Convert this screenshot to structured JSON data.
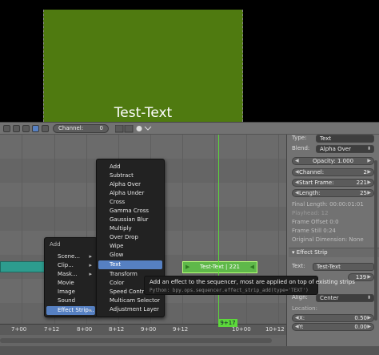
{
  "preview": {
    "text": "Test-Text"
  },
  "header": {
    "channel_label": "Channel:",
    "channel_value": "0"
  },
  "strip": {
    "label": "Test-Text | 221"
  },
  "ruler": {
    "ticks": [
      "7+00",
      "7+12",
      "8+00",
      "8+12",
      "9+00",
      "9+12",
      "10+00",
      "10+12"
    ],
    "current_frame": "9+17"
  },
  "properties": {
    "type_label": "Type:",
    "type_value": "Text",
    "blend_label": "Blend:",
    "blend_value": "Alpha Over",
    "opacity_label": "Opacity:",
    "opacity_value": "1.000",
    "channel_label": "Channel:",
    "channel_value": "2",
    "start_label": "Start Frame:",
    "start_value": "221",
    "length_label": "Length:",
    "length_value": "25",
    "final_length": "Final Length: 00:00:01:01",
    "playhead": "Playhead: 12",
    "frame_offset": "Frame Offset 0:0",
    "frame_still": "Frame Still 0:24",
    "orig_dim": "Original Dimension: None",
    "effect_strip_title": "Effect Strip",
    "text_label": "Text:",
    "text_value": "Test-Text",
    "size_value": "139",
    "align_label": "Align:",
    "align_value": "Center",
    "location_label": "Location:",
    "x_label": "X:",
    "x_value": "0.50",
    "y_label": "Y:",
    "y_value": "0.00"
  },
  "add_menu": {
    "title": "Add",
    "items": [
      {
        "label": "Scene..."
      },
      {
        "label": "Clip..."
      },
      {
        "label": "Mask..."
      },
      {
        "label": "Movie"
      },
      {
        "label": "Image"
      },
      {
        "label": "Sound"
      },
      {
        "label": "Effect Strip..."
      }
    ]
  },
  "effect_menu": {
    "items": [
      {
        "label": "Add"
      },
      {
        "label": "Subtract"
      },
      {
        "label": "Alpha Over"
      },
      {
        "label": "Alpha Under"
      },
      {
        "label": "Cross"
      },
      {
        "label": "Gamma Cross"
      },
      {
        "label": "Gaussian Blur"
      },
      {
        "label": "Multiply"
      },
      {
        "label": "Over Drop"
      },
      {
        "label": "Wipe"
      },
      {
        "label": "Glow"
      },
      {
        "label": "Text"
      },
      {
        "label": "Transform"
      },
      {
        "label": "Color"
      },
      {
        "label": "Speed Control"
      },
      {
        "label": "Multicam Selector"
      },
      {
        "label": "Adjustment Layer"
      }
    ]
  },
  "tooltip": {
    "description": "Add an effect to the sequencer, most are applied on top of existing strips",
    "python": "Python: bpy.ops.sequencer.effect_strip_add(type='TEXT')"
  },
  "colors": {
    "highlight": "#5680c2",
    "playhead": "#5cd83a",
    "text_strip": "#5fb84a",
    "preview_bg": "#4f7a10"
  }
}
